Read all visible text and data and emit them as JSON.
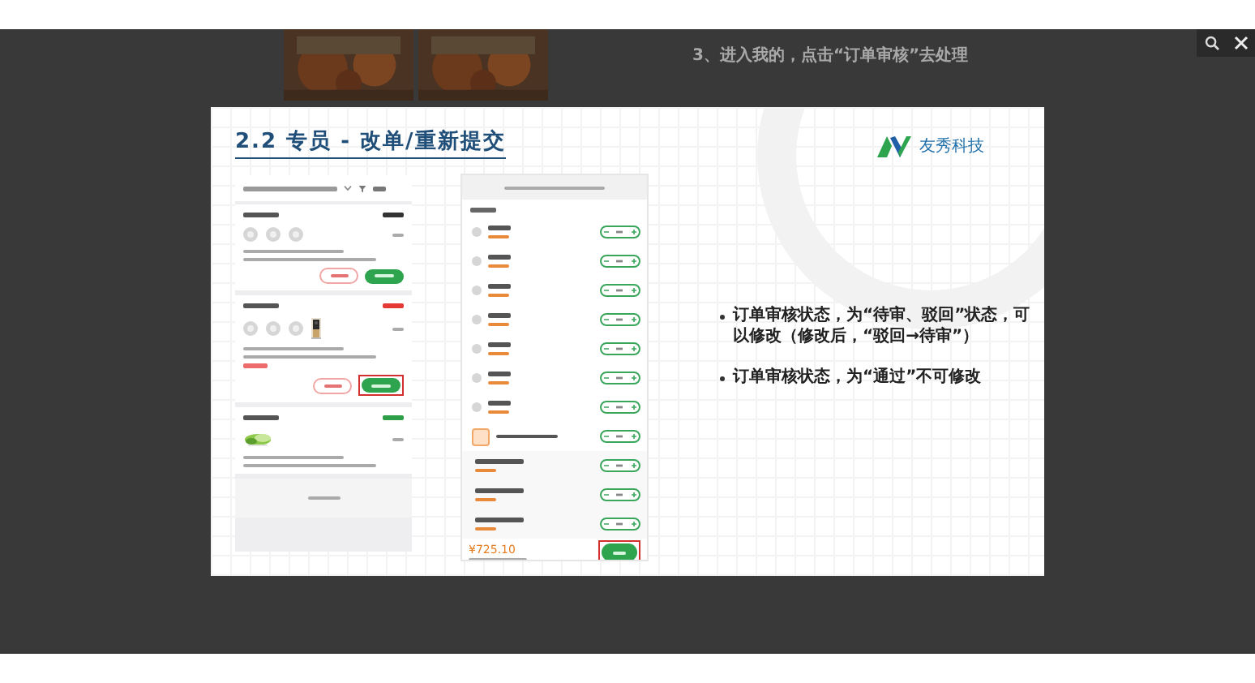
{
  "background_page": {
    "step_text": "3、进入我的，点击“订单审核”去处理",
    "pictures": [
      {
        "kind": "picture"
      },
      {
        "kind": "picture"
      }
    ]
  },
  "slide": {
    "title": "2.2 专员 - 改单/重新提交",
    "logo_text": "友秀科技",
    "order_list": {
      "orders": [
        {
          "color": "#333333",
          "thumbs": [
            {
              "kind": "placeholder"
            },
            {
              "kind": "placeholder"
            },
            {
              "kind": "placeholder"
            }
          ],
          "reject_reason": false,
          "buttons": true,
          "highlighted": false
        },
        {
          "color": "#e53935",
          "thumbs": [
            {
              "kind": "placeholder"
            },
            {
              "kind": "placeholder"
            },
            {
              "kind": "placeholder"
            },
            {
              "kind": "picture"
            }
          ],
          "reject_reason": true,
          "buttons": true,
          "highlighted": true
        },
        {
          "color": "#2e9e48",
          "thumbs": [
            {
              "kind": "picture"
            }
          ],
          "reject_reason": false,
          "buttons": false
        }
      ]
    },
    "cart": {
      "items": [
        {
          "kind": "item"
        },
        {
          "kind": "item"
        },
        {
          "kind": "item"
        },
        {
          "kind": "item"
        },
        {
          "kind": "item"
        },
        {
          "kind": "item"
        },
        {
          "kind": "item"
        },
        {
          "kind": "combo"
        },
        {
          "kind": "sub"
        },
        {
          "kind": "sub"
        },
        {
          "kind": "sub"
        }
      ],
      "total": "¥725.10",
      "save_highlighted": true
    },
    "bullets": [
      "订单审核状态，为“待审、驳回”状态，可以修改（修改后，“驳回→待审”）",
      "订单审核状态，为“通过”不可修改"
    ]
  }
}
